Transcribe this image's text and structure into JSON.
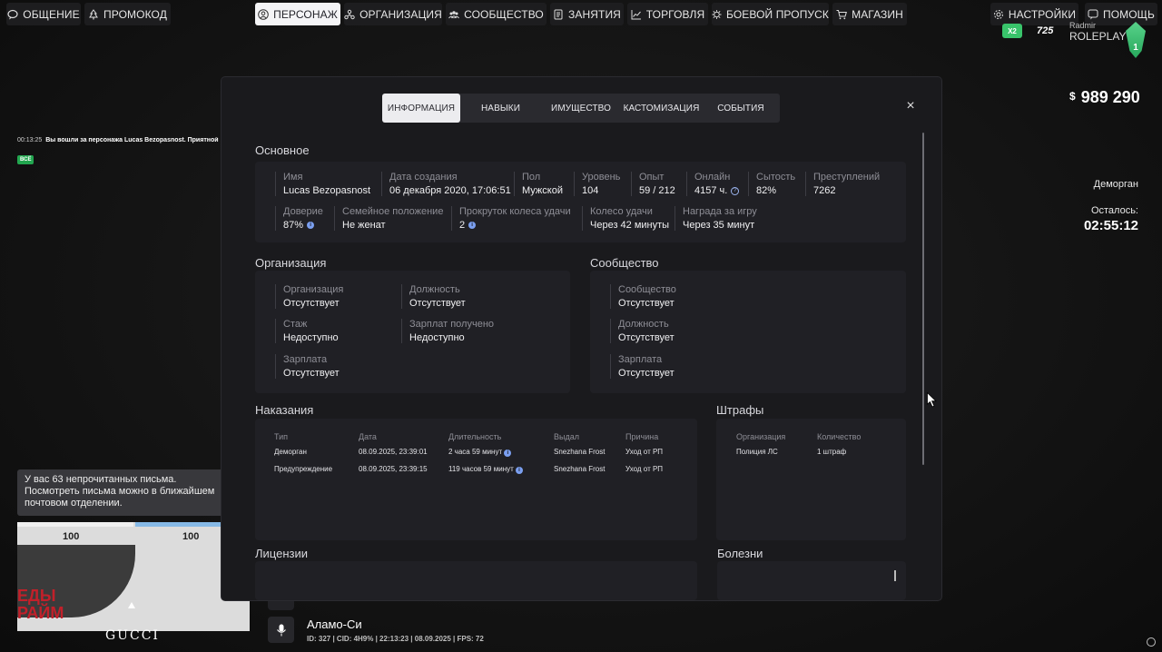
{
  "nav": {
    "left": [
      {
        "label": "ОБЩЕНИЕ",
        "icon": "chat-icon"
      },
      {
        "label": "ПРОМОКОД",
        "icon": "tree-icon"
      }
    ],
    "center": [
      {
        "label": "ПЕРСОНАЖ",
        "icon": "person-icon",
        "active": true
      },
      {
        "label": "ОРГАНИЗАЦИЯ",
        "icon": "org-icon"
      },
      {
        "label": "СООБЩЕСТВО",
        "icon": "community-icon"
      },
      {
        "label": "ЗАНЯТИЯ",
        "icon": "book-icon"
      },
      {
        "label": "ТОРГОВЛЯ",
        "icon": "chart-icon"
      },
      {
        "label": "БОЕВОЙ ПРОПУСК",
        "icon": "gear-badge-icon"
      },
      {
        "label": "МАГАЗИН",
        "icon": "cart-icon"
      }
    ],
    "right": [
      {
        "label": "НАСТРОЙКИ",
        "icon": "settings-icon"
      },
      {
        "label": "ПОМОЩЬ",
        "icon": "help-icon"
      }
    ]
  },
  "hud": {
    "money_symbol": "$",
    "money": "989 290",
    "logo_x2": "X2",
    "logo_num": "725",
    "logo_brand_top": "Radmir",
    "logo_brand": "ROLEPLAY",
    "logo_gem": "1",
    "event_name": "Деморган",
    "event_left_label": "Осталось:",
    "event_time": "02:55:12"
  },
  "chat": {
    "timestamp": "00:13:25",
    "message": "Вы вошли за персонажа Lucas Bezopasnost. Приятной",
    "tag": "ВСЁ"
  },
  "notice": "У вас 63 непрочитанных письма. Посмотреть письма можно в ближайшем почтовом отделении.",
  "minimap": {
    "stat1": "100",
    "stat2": "100",
    "sign": "ЕДЫ\nРАЙМ",
    "store": "GUCCI"
  },
  "location": {
    "name": "Аламо-Си",
    "info": "ID: 327 | CID: 4H9% | 22:13:23  | 08.09.2025 | FPS: 72"
  },
  "modal": {
    "tabs": [
      {
        "label": "ИНФОРМАЦИЯ",
        "active": true
      },
      {
        "label": "НАВЫКИ"
      },
      {
        "label": "ИМУЩЕСТВО"
      },
      {
        "label": "КАСТОМИЗАЦИЯ"
      },
      {
        "label": "СОБЫТИЯ"
      }
    ],
    "close": "×",
    "main": {
      "title": "Основное",
      "row1": [
        {
          "label": "Имя",
          "value": "Lucas Bezopasnost"
        },
        {
          "label": "Дата создания",
          "value": "06 декабря 2020, 17:06:51"
        },
        {
          "label": "Пол",
          "value": "Мужской"
        },
        {
          "label": "Уровень",
          "value": "104"
        },
        {
          "label": "Опыт",
          "value": "59 / 212"
        },
        {
          "label": "Онлайн",
          "value": "4157 ч."
        },
        {
          "label": "Сытость",
          "value": "82%"
        },
        {
          "label": "Преступлений",
          "value": "7262"
        }
      ],
      "row2": [
        {
          "label": "Доверие",
          "value": "87%"
        },
        {
          "label": "Семейное положение",
          "value": "Не женат"
        },
        {
          "label": "Прокруток колеса удачи",
          "value": "2"
        },
        {
          "label": "Колесо удачи",
          "value": "Через 42 минуты"
        },
        {
          "label": "Награда за игру",
          "value": "Через 35 минут"
        }
      ]
    },
    "organization": {
      "title": "Организация",
      "fields": [
        {
          "label": "Организация",
          "value": "Отсутствует"
        },
        {
          "label": "Должность",
          "value": "Отсутствует"
        },
        {
          "label": "Стаж",
          "value": "Недоступно"
        },
        {
          "label": "Зарплат получено",
          "value": "Недоступно"
        },
        {
          "label": "Зарплата",
          "value": "Отсутствует"
        }
      ]
    },
    "community": {
      "title": "Сообщество",
      "fields": [
        {
          "label": "Сообщество",
          "value": "Отсутствует"
        },
        {
          "label": "Должность",
          "value": "Отсутствует"
        },
        {
          "label": "Зарплата",
          "value": "Отсутствует"
        }
      ]
    },
    "punishments": {
      "title": "Наказания",
      "headers": [
        "Тип",
        "Дата",
        "Длительность",
        "Выдал",
        "Причина"
      ],
      "rows": [
        [
          "Деморган",
          "08.09.2025, 23:39:01",
          "2 часа 59 минут",
          "Snezhana Frost",
          "Уход от РП"
        ],
        [
          "Предупреждение",
          "08.09.2025, 23:39:15",
          "119 часов 59 минут",
          "Snezhana Frost",
          "Уход от РП"
        ]
      ]
    },
    "fines": {
      "title": "Штрафы",
      "headers": [
        "Организация",
        "Количество"
      ],
      "rows": [
        [
          "Полиция ЛС",
          "1 штраф"
        ]
      ]
    },
    "licenses": {
      "title": "Лицензии"
    },
    "diseases": {
      "title": "Болезни"
    }
  }
}
